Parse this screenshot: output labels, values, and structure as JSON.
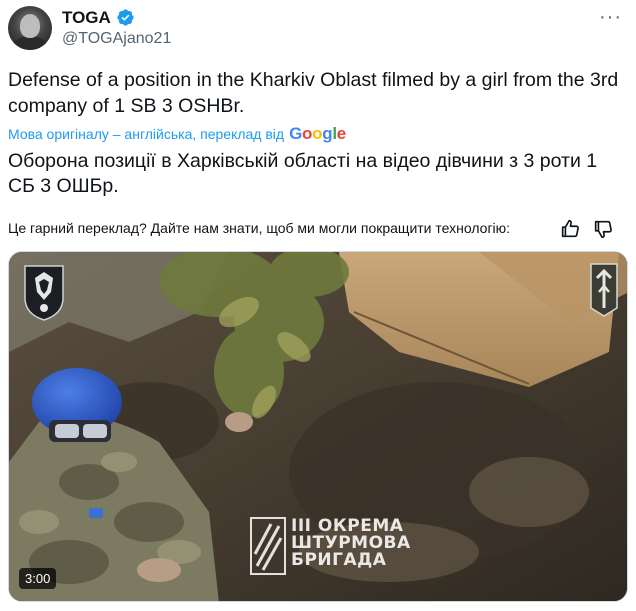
{
  "author": {
    "name": "TOGA",
    "handle": "@TOGAjano21",
    "verified": true
  },
  "menu": {
    "icon": "more-dots-icon",
    "glyph": "···"
  },
  "tweet": {
    "text": "Defense of a position in the Kharkiv Oblast filmed by a girl from the 3rd company of 1 SB 3 OSHBr."
  },
  "translation": {
    "attribution": "Мова оригіналу – англійська, переклад від",
    "provider_letters": [
      "G",
      "o",
      "o",
      "g",
      "l",
      "e"
    ],
    "text": "Оборона позиції в Харківській області на відео дівчини з 3 роти 1 СБ 3 ОШБр.",
    "feedback_prompt": "Це гарний переклад? Дайте нам знати, щоб ми могли покращити технологію:"
  },
  "media": {
    "duration": "3:00",
    "watermark_lines": [
      "III ОКРЕМА",
      "ШТУРМОВА",
      "БРИГАДА"
    ]
  },
  "colors": {
    "accent": "#1d9bf0",
    "verified": "#1d9bf0",
    "secondary_text": "#536471"
  }
}
